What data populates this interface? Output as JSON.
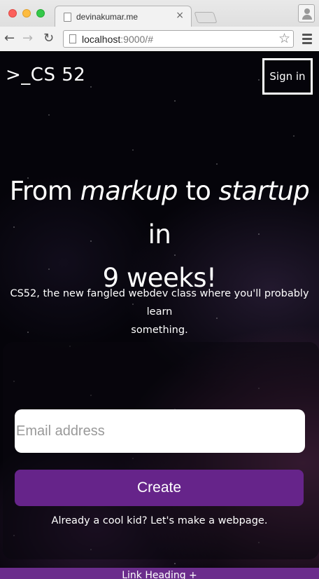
{
  "browser": {
    "tab_title": "devinakumar.me",
    "tab_close": "×",
    "url_host": "localhost",
    "url_rest": ":9000/#",
    "back_glyph": "←",
    "forward_glyph": "→",
    "reload_glyph": "↻",
    "bookmark_glyph": "☆"
  },
  "header": {
    "brand": ">_CS 52",
    "signin_label": "Sign in"
  },
  "hero": {
    "line1_a": "From ",
    "line1_em1": "markup",
    "line1_b": " to ",
    "line1_em2": "startup",
    "line1_c": " in",
    "line2": "9 weeks!"
  },
  "subtitle": {
    "line1": "CS52, the new fangled webdev class where you'll probably learn",
    "line2": "something."
  },
  "signup": {
    "email_placeholder": "Email address",
    "create_label": "Create",
    "cool_kid_text": "Already a cool kid? Let's make a webpage."
  },
  "footer": {
    "link_heading": "Link Heading +"
  },
  "colors": {
    "accent": "#66248a"
  }
}
